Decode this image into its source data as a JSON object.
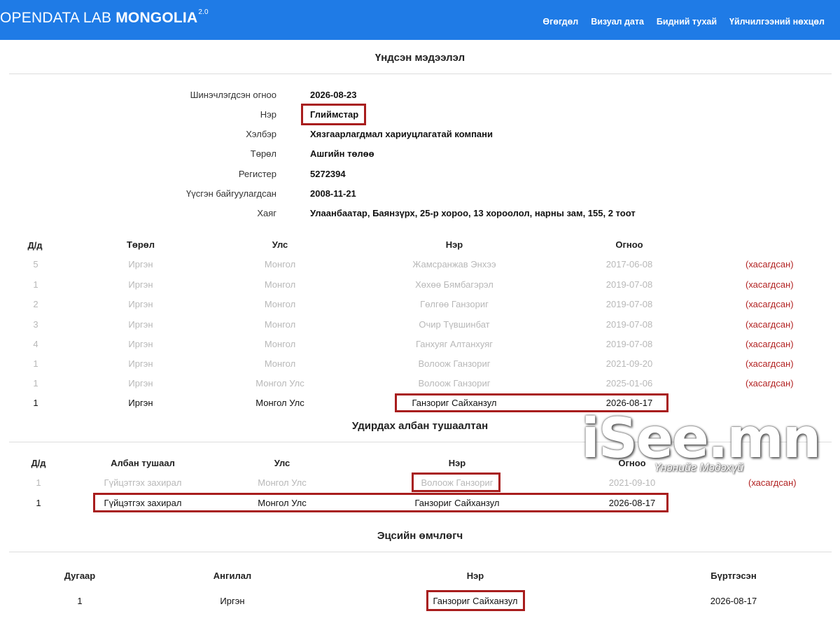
{
  "header": {
    "brand_light": "OPENDATA LAB ",
    "brand_bold": "MONGOLIA",
    "brand_version": "2.0",
    "nav": [
      "Өгөгдөл",
      "Визуал дата",
      "Бидний тухай",
      "Үйлчилгээний нөхцөл"
    ]
  },
  "basic_info": {
    "title": "Үндсэн мэдээлэл",
    "rows": [
      {
        "label": "Шинэчлэгдсэн огноо",
        "value": "2026-08-23"
      },
      {
        "label": "Нэр",
        "value": "Глиймстар"
      },
      {
        "label": "Хэлбэр",
        "value": "Хязгаарлагдмал хариуцлагатай компани"
      },
      {
        "label": "Төрөл",
        "value": "Ашгийн төлөө"
      },
      {
        "label": "Регистер",
        "value": "5272394"
      },
      {
        "label": "Үүсгэн байгуулагдсан",
        "value": "2008-11-21"
      },
      {
        "label": "Хаяг",
        "value": "Улаанбаатар, Баянзүрх, 25-р хороо, 13 хороолол, нарны зам, 155, 2 тоот"
      }
    ]
  },
  "shareholders": {
    "headers": [
      "Д/д",
      "Төрөл",
      "Улс",
      "Нэр",
      "Огноо"
    ],
    "rows": [
      {
        "no": "5",
        "type": "Иргэн",
        "country": "Монгол",
        "name": "Жамсранжав Энхээ",
        "date": "2017-06-08",
        "status": "(хасагдсан)"
      },
      {
        "no": "1",
        "type": "Иргэн",
        "country": "Монгол",
        "name": "Хөхөө Бямбагэрэл",
        "date": "2019-07-08",
        "status": "(хасагдсан)"
      },
      {
        "no": "2",
        "type": "Иргэн",
        "country": "Монгол",
        "name": "Гөлгөө Ганзориг",
        "date": "2019-07-08",
        "status": "(хасагдсан)"
      },
      {
        "no": "3",
        "type": "Иргэн",
        "country": "Монгол",
        "name": "Очир Түвшинбат",
        "date": "2019-07-08",
        "status": "(хасагдсан)"
      },
      {
        "no": "4",
        "type": "Иргэн",
        "country": "Монгол",
        "name": "Ганхуяг Алтанхуяг",
        "date": "2019-07-08",
        "status": "(хасагдсан)"
      },
      {
        "no": "1",
        "type": "Иргэн",
        "country": "Монгол",
        "name": "Волоож Ганзориг",
        "date": "2021-09-20",
        "status": "(хасагдсан)"
      },
      {
        "no": "1",
        "type": "Иргэн",
        "country": "Монгол Улс",
        "name": "Волоож Ганзориг",
        "date": "2025-01-06",
        "status": "(хасагдсан)"
      },
      {
        "no": "1",
        "type": "Иргэн",
        "country": "Монгол Улс",
        "name": "Ганзориг Сайханзул",
        "date": "2026-08-17",
        "status": ""
      }
    ]
  },
  "officials": {
    "title": "Удирдах албан тушаалтан",
    "headers": [
      "Д/д",
      "Албан тушаал",
      "Улс",
      "Нэр",
      "Огноо"
    ],
    "rows": [
      {
        "no": "1",
        "position": "Гүйцэтгэх захирал",
        "country": "Монгол Улс",
        "name": "Волоож Ганзориг",
        "date": "2021-09-10",
        "status": "(хасагдсан)"
      },
      {
        "no": "1",
        "position": "Гүйцэтгэх захирал",
        "country": "Монгол Улс",
        "name": "Ганзориг Сайханзул",
        "date": "2026-08-17",
        "status": ""
      }
    ]
  },
  "beneficial_owner": {
    "title": "Эцсийн өмчлөгч",
    "headers": [
      "Дугаар",
      "Ангилал",
      "Нэр",
      "Бүртгэсэн"
    ],
    "rows": [
      {
        "no": "1",
        "category": "Иргэн",
        "name": "Ганзориг Сайханзул",
        "registered": "2026-08-17"
      }
    ]
  },
  "watermark": {
    "text": "iSee.mn",
    "subtext": "Үнэнийг Мэдэхүй"
  }
}
